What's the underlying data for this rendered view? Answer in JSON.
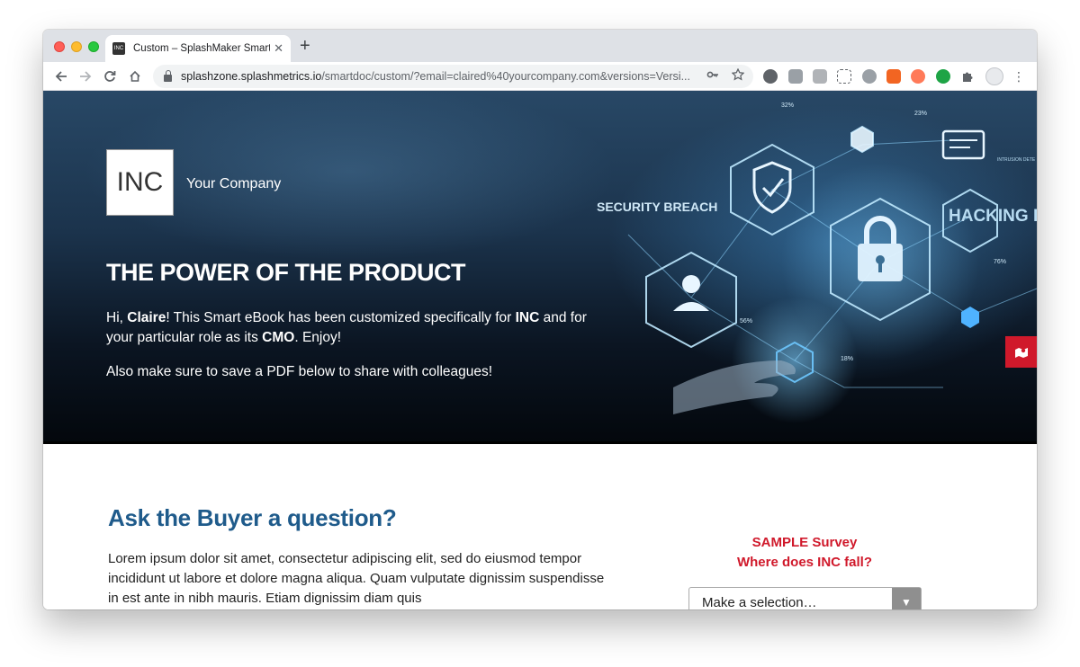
{
  "browser": {
    "tab_title": "Custom – SplashMaker SmartDoc",
    "favicon_text": "INC",
    "new_tab_label": "+",
    "tab_close_label": "✕",
    "url_host": "splashzone.splashmetrics.io",
    "url_path": "/smartdoc/custom/?email=claired%40yourcompany.com&versions=Versi..."
  },
  "hero": {
    "logo_text": "INC",
    "company_name": "Your Company",
    "title": "THE POWER OF THE PRODUCT",
    "greeting_1": "Hi, ",
    "name": "Claire",
    "greeting_2": "! This Smart eBook has been customized specifically for ",
    "company": "INC",
    "greeting_3": " and for your particular role as its ",
    "role": "CMO",
    "greeting_4": ". Enjoy!",
    "pdf_note": "Also make sure to save a PDF below to share with colleagues!",
    "art_labels": {
      "security_breach": "SECURITY BREACH",
      "hacking": "HACKING D",
      "intrusion": "INTRUSION DETE",
      "pct_32": "32%",
      "pct_23": "23%",
      "pct_56": "56%",
      "pct_18": "18%",
      "pct_76": "76%"
    }
  },
  "section": {
    "title": "Ask the Buyer a question?",
    "body": "Lorem ipsum dolor sit amet, consectetur adipiscing elit, sed do eiusmod tempor incididunt ut labore et dolore magna aliqua. Quam vulputate dignissim suspendisse in est ante in nibh mauris. Etiam dignissim diam quis"
  },
  "survey": {
    "line1": "SAMPLE Survey",
    "line2": "Where does INC fall?",
    "select_value": "Make a selection…"
  },
  "colors": {
    "accent_red": "#d0192b",
    "title_blue": "#1f5b8b"
  }
}
